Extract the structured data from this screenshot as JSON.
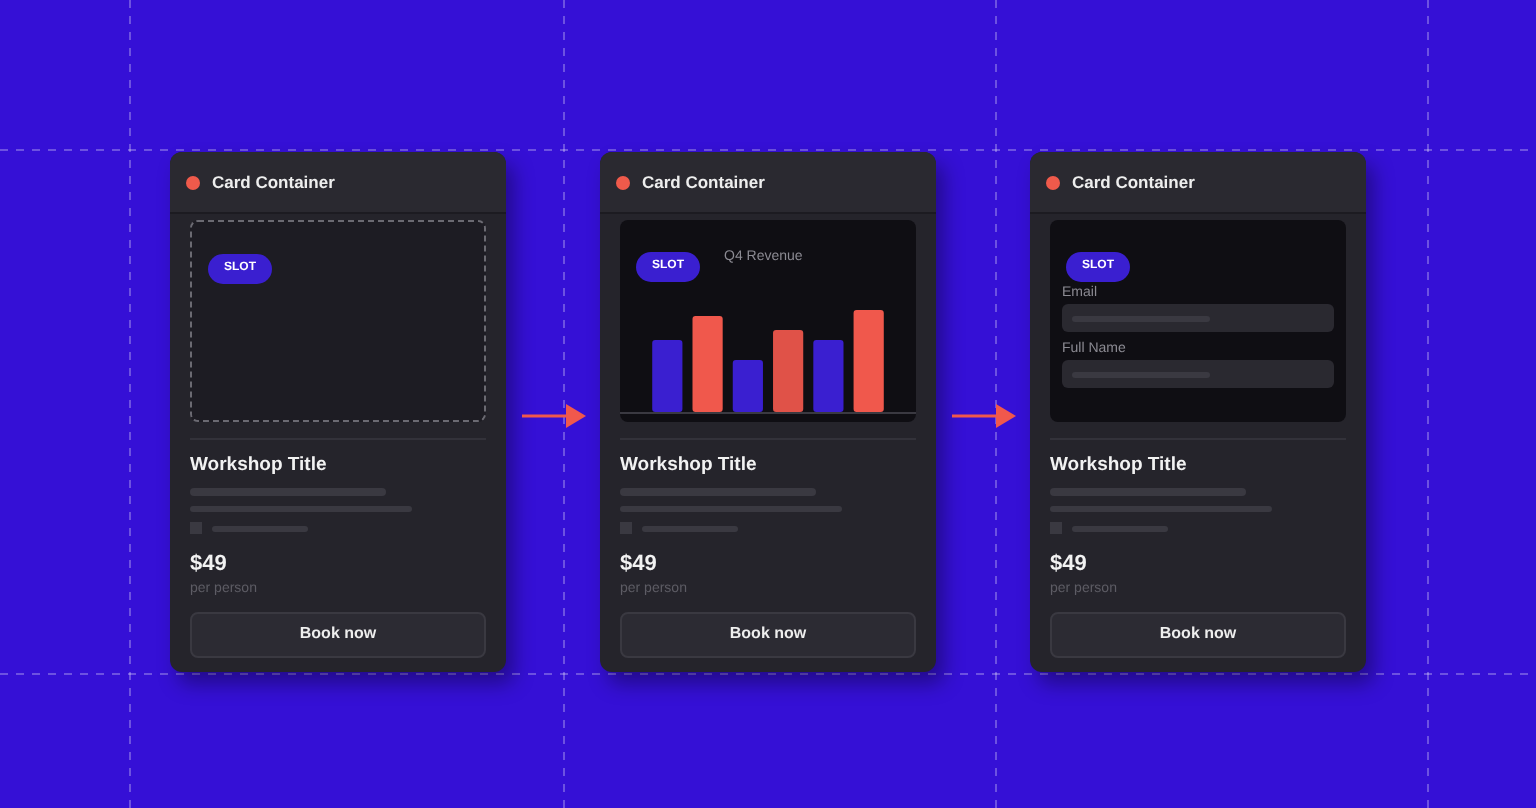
{
  "cards": [
    {
      "header": "Card Container",
      "slot": {
        "kind": "empty",
        "badge": "SLOT"
      },
      "title": "Workshop Title",
      "price": "$49",
      "price_unit": "per person",
      "button": "Book now"
    },
    {
      "header": "Card Container",
      "slot": {
        "kind": "chart",
        "badge": "SLOT",
        "caption": "Q4 Revenue"
      },
      "title": "Workshop Title",
      "price": "$49",
      "price_unit": "per person",
      "button": "Book now"
    },
    {
      "header": "Card Container",
      "slot": {
        "kind": "form",
        "badge": "SLOT",
        "fields": [
          {
            "label": "Email"
          },
          {
            "label": "Full Name"
          }
        ]
      },
      "title": "Workshop Title",
      "price": "$49",
      "price_unit": "per person",
      "button": "Book now"
    }
  ]
}
